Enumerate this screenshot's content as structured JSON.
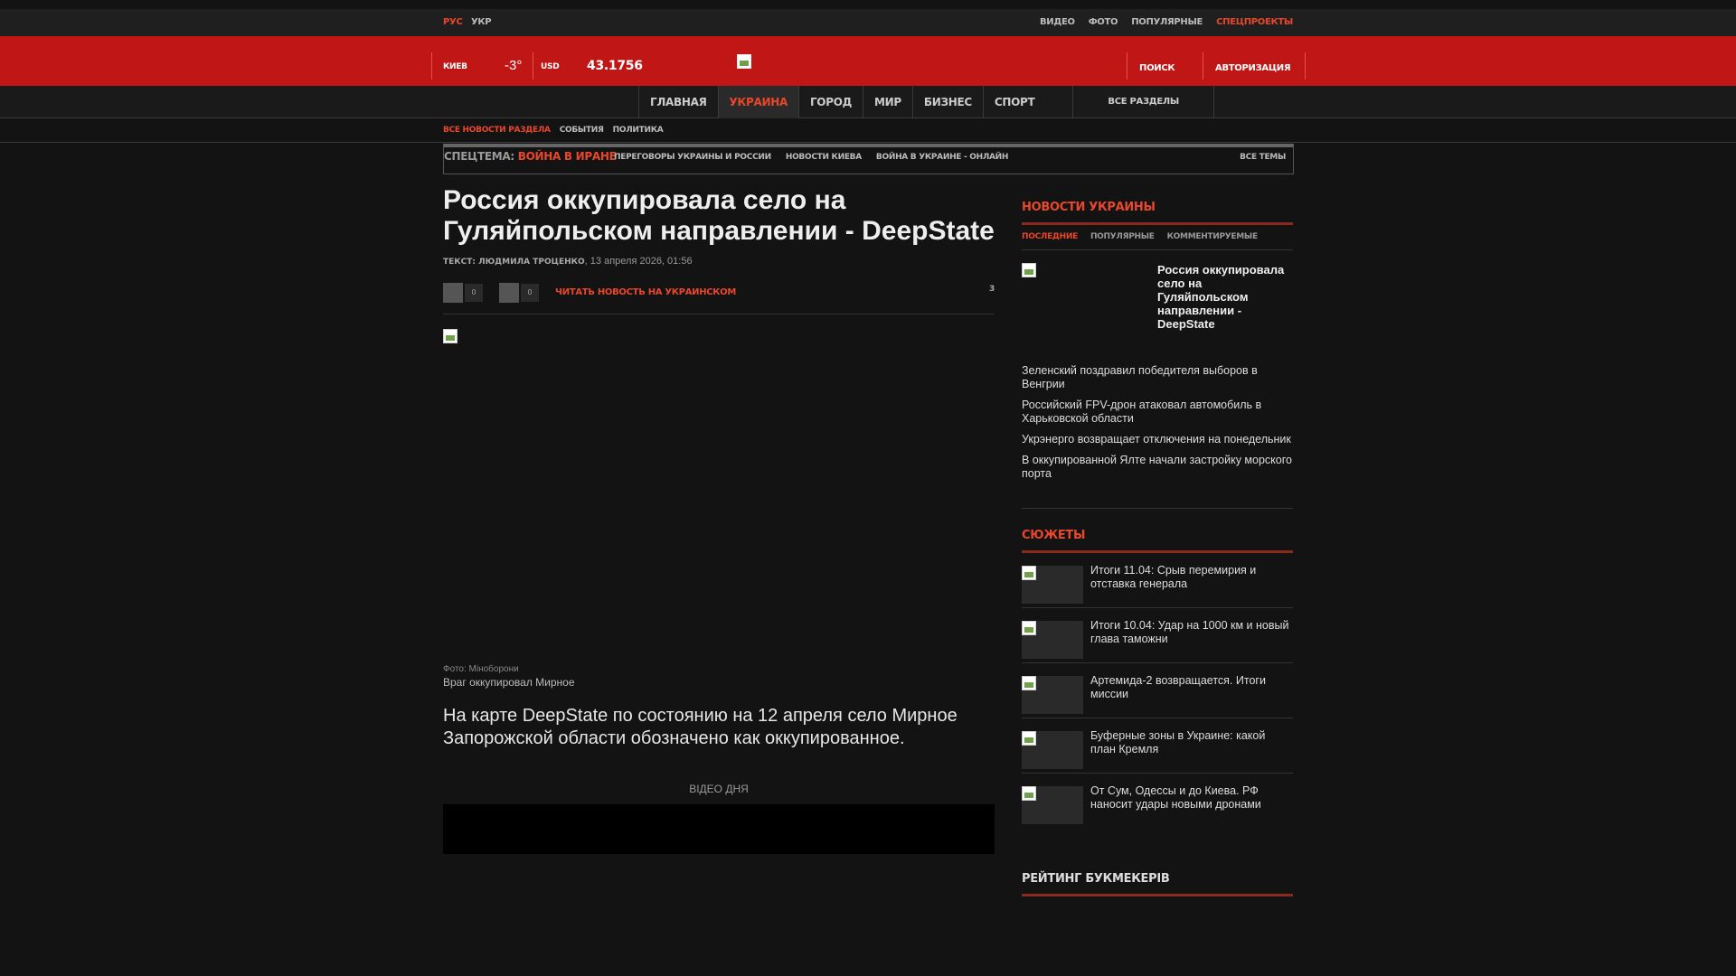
{
  "topbar": {
    "lang_rus": "РУС",
    "lang_ukr": "УКР",
    "nav": [
      "ВИДЕО",
      "ФОТО",
      "ПОПУЛЯРНЫЕ"
    ],
    "special": "СПЕЦПРОЕКТЫ"
  },
  "header": {
    "city": "КИЕВ",
    "temperature": "-3°",
    "currency": "USD",
    "rate": "43.1756",
    "search": "ПОИСК",
    "auth": "АВТОРИЗАЦИЯ"
  },
  "mainnav": {
    "items": [
      "ГЛАВНАЯ",
      "УКРАИНА",
      "ГОРОД",
      "МИР",
      "БИЗНЕС",
      "СПОРТ"
    ],
    "all": "ВСЕ РАЗДЕЛЫ"
  },
  "subnav": [
    "ВСЕ НОВОСТИ РАЗДЕЛА",
    "СОБЫТИЯ",
    "ПОЛИТИКА"
  ],
  "special_topics": {
    "label": "СПЕЦТЕМА:",
    "main": "ВОЙНА В ИРАНЕ",
    "links": [
      "ПЕРЕГОВОРЫ УКРАИНЫ И РОССИИ",
      "НОВОСТИ КИЕВА",
      "ВОЙНА В УКРАИНЕ - ОНЛАЙН"
    ],
    "all": "ВСЕ ТЕМЫ"
  },
  "article": {
    "title": "Россия оккупировала село на Гуляйпольском направлении - DeepState",
    "author": "ТЕКСТ: ЛЮДМИЛА ТРОЦЕНКО",
    "date": "13 апреля 2026, 01:56",
    "share_count_1": "0",
    "share_count_2": "0",
    "ukr_link": "ЧИТАТЬ НОВОСТЬ НА УКРАИНСКОМ",
    "comments": "3",
    "photo_credit": "Фото: Міноборони",
    "photo_caption": "Враг оккупировал Мирное",
    "lead": "На карте DeepState по состоянию на 12 апреля село Мирное Запорожской области обозначено как оккупированное.",
    "video_label": "ВІДЕО ДНЯ"
  },
  "sidebar": {
    "news_head": "НОВОСТИ УКРАИНЫ",
    "tabs": [
      "ПОСЛЕДНИЕ",
      "ПОПУЛЯРНЫЕ",
      "КОММЕНТИРУЕМЫЕ"
    ],
    "top_news": "Россия оккупировала село на Гуляйпольском направлении - DeepState",
    "news": [
      "Зеленский поздравил победителя выборов в Венгрии",
      "Российский FPV-дрон атаковал автомобиль в Харьковской области",
      "Укрэнерго возвращает отключения на понедельник",
      "В оккупированной Ялте начали застройку морского порта"
    ],
    "stories_head": "СЮЖЕТЫ",
    "stories": [
      "Итоги 11.04: Срыв перемирия и отставка генерала",
      "Итоги 10.04: Удар на 1000 км и новый глава таможни",
      "Артемида-2 возвращается. Итоги миссии",
      "Буферные зоны в Украине: какой план Кремля",
      "От Сум, Одессы и до Киева. РФ наносит удары новыми дронами"
    ],
    "bookie_head": "РЕЙТИНГ БУКМЕКЕРІВ"
  }
}
